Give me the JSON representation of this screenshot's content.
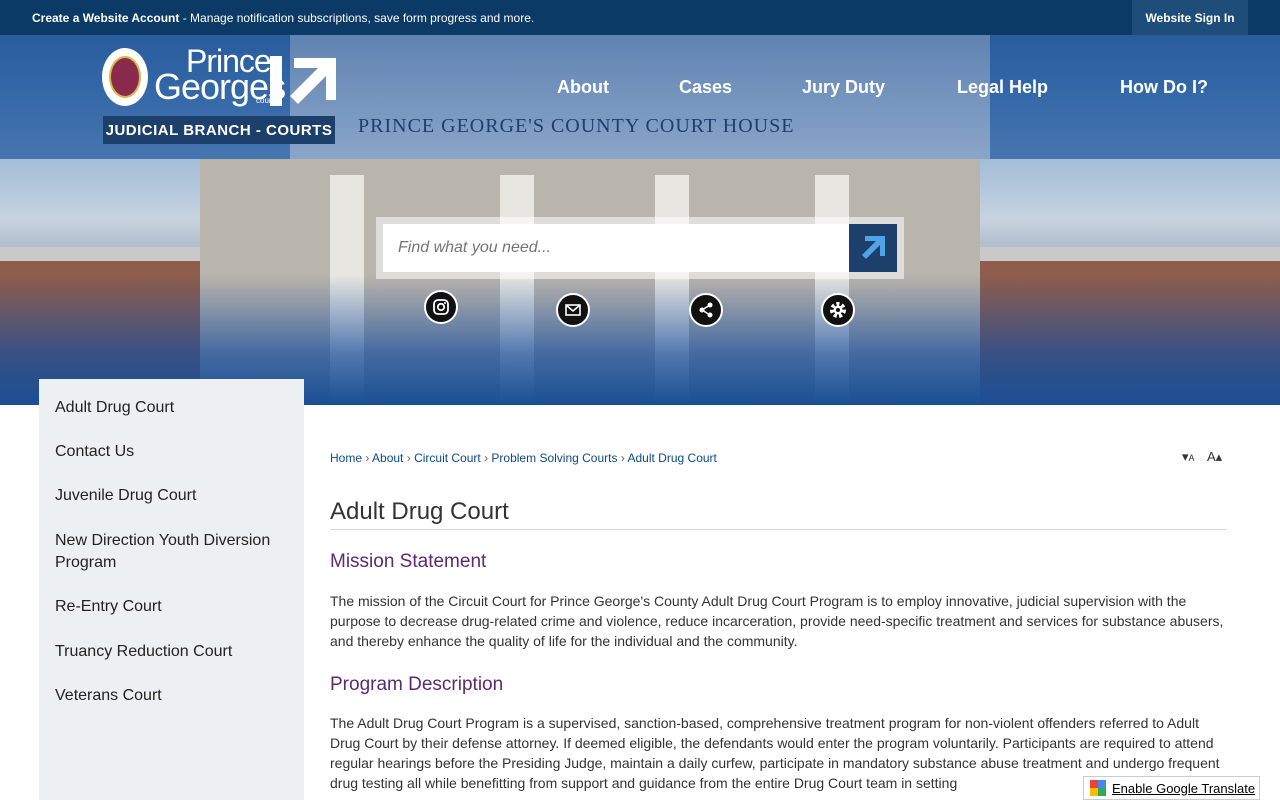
{
  "topbar": {
    "notice_bold": "Create a Website Account",
    "notice_rest": " - Manage notification subscriptions, save form progress and more.",
    "signin": "Website Sign In"
  },
  "logo": {
    "prince": "Prince",
    "georges": "Georges",
    "county": "county",
    "badge": "JUDICIAL BRANCH - COURTS"
  },
  "hero": {
    "building_text": "PRINCE GEORGE'S COUNTY COURT HOUSE"
  },
  "nav": [
    "About",
    "Cases",
    "Jury Duty",
    "Legal Help",
    "How Do I?"
  ],
  "search": {
    "placeholder": "Find what you need..."
  },
  "social": [
    "instagram-icon",
    "email-icon",
    "share-icon",
    "settings-icon"
  ],
  "sidebar": [
    "Adult Drug Court",
    "Contact Us",
    "Juvenile Drug Court",
    "New Direction Youth Diversion Program",
    "Re-Entry Court",
    "Truancy Reduction Court",
    "Veterans Court"
  ],
  "breadcrumb": [
    "Home",
    "About",
    "Circuit Court",
    "Problem Solving Courts",
    "Adult Drug Court"
  ],
  "font_controls": {
    "decrease": "A",
    "increase": "A"
  },
  "page": {
    "title": "Adult Drug Court",
    "mission_heading": "Mission Statement",
    "mission_text": "The mission of the Circuit Court for Prince George's County Adult Drug Court Program is to employ innovative, judicial supervision with the purpose to decrease drug-related crime and violence, reduce incarceration, provide need-specific treatment and services for substance abusers, and thereby enhance the quality of life for the individual and the community.",
    "program_heading": "Program Description",
    "program_text": "The Adult Drug Court Program is a supervised, sanction-based, comprehensive treatment program for non-violent offenders referred to Adult Drug Court by their defense attorney. If deemed eligible, the defendants would enter the program voluntarily. Participants are required to attend regular hearings before the Presiding Judge, maintain a daily curfew, participate in mandatory substance abuse treatment and undergo frequent drug testing all while benefitting from support and guidance from the entire Drug Court team in setting"
  },
  "translate": {
    "label": "Enable Google Translate"
  },
  "colors": {
    "navy": "#0b3a66",
    "heading_purple": "#5d2a6d",
    "link_blue": "#0b4a8a"
  }
}
